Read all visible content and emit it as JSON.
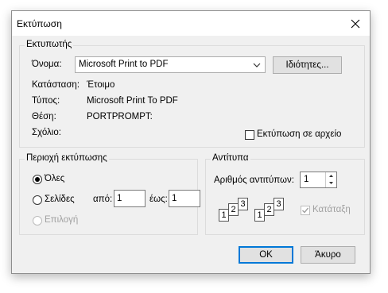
{
  "title": "Εκτύπωση",
  "printer": {
    "group_label": "Εκτυπωτής",
    "name_label": "Όνομα:",
    "name_value": "Microsoft Print to PDF",
    "properties_button": "Ιδιότητες...",
    "status_label": "Κατάσταση:",
    "status_value": "Έτοιμο",
    "type_label": "Τύπος:",
    "type_value": "Microsoft Print To PDF",
    "location_label": "Θέση:",
    "location_value": "PORTPROMPT:",
    "comment_label": "Σχόλιο:",
    "print_to_file_label": "Εκτύπωση σε αρχείο",
    "print_to_file_checked": false
  },
  "range": {
    "group_label": "Περιοχή εκτύπωσης",
    "all_label": "Όλες",
    "pages_label": "Σελίδες",
    "from_label": "από:",
    "from_value": "1",
    "to_label": "έως:",
    "to_value": "1",
    "selection_label": "Επιλογή",
    "selected": "all"
  },
  "copies": {
    "group_label": "Αντίτυπα",
    "count_label": "Αριθμός αντιτύπων:",
    "count_value": "1",
    "collate_label": "Κατάταξη",
    "collate_checked": true,
    "page_numbers": [
      "1",
      "2",
      "3"
    ]
  },
  "buttons": {
    "ok": "OK",
    "cancel": "Άκυρο"
  }
}
